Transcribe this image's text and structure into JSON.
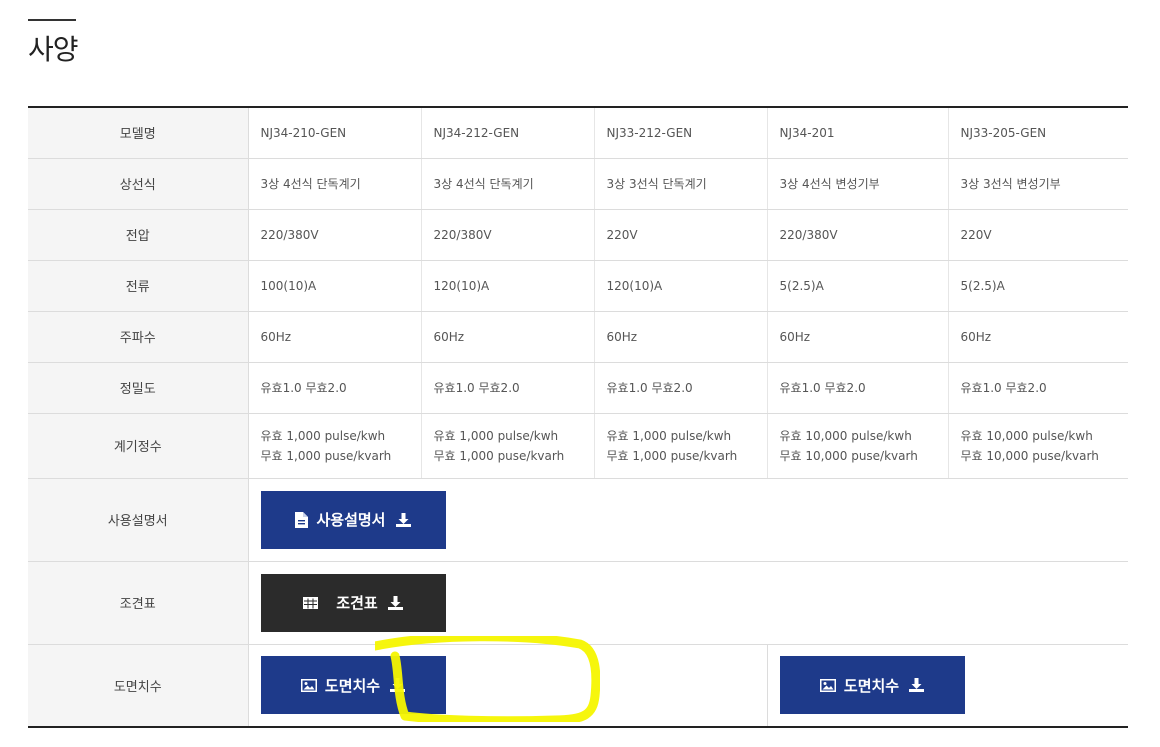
{
  "page": {
    "title": "사양"
  },
  "table": {
    "rows": [
      {
        "label": "모델명",
        "cells": [
          "NJ34-210-GEN",
          "NJ34-212-GEN",
          "NJ33-212-GEN",
          "NJ34-201",
          "NJ33-205-GEN"
        ]
      },
      {
        "label": "상선식",
        "cells": [
          "3상 4선식 단독계기",
          "3상 4선식 단독계기",
          "3상 3선식 단독계기",
          "3상 4선식 변성기부",
          "3상 3선식 변성기부"
        ]
      },
      {
        "label": "전압",
        "cells": [
          "220/380V",
          "220/380V",
          "220V",
          "220/380V",
          "220V"
        ]
      },
      {
        "label": "전류",
        "cells": [
          "100(10)A",
          "120(10)A",
          "120(10)A",
          "5(2.5)A",
          "5(2.5)A"
        ]
      },
      {
        "label": "주파수",
        "cells": [
          "60Hz",
          "60Hz",
          "60Hz",
          "60Hz",
          "60Hz"
        ]
      },
      {
        "label": "정밀도",
        "cells": [
          "유효1.0 무효2.0",
          "유효1.0 무효2.0",
          "유효1.0 무효2.0",
          "유효1.0 무효2.0",
          "유효1.0 무효2.0"
        ]
      },
      {
        "label": "계기정수",
        "cells": [
          [
            "유효 1,000 pulse/kwh",
            "무효 1,000 puse/kvarh"
          ],
          [
            "유효 1,000 pulse/kwh",
            "무효 1,000 puse/kvarh"
          ],
          [
            "유효 1,000 pulse/kwh",
            "무효 1,000 puse/kvarh"
          ],
          [
            "유효 10,000 pulse/kwh",
            "무효 10,000 puse/kvarh"
          ],
          [
            "유효 10,000 pulse/kwh",
            "무효 10,000 puse/kvarh"
          ]
        ]
      },
      {
        "label": "사용설명서",
        "button": "사용설명서"
      },
      {
        "label": "조견표",
        "button": "조견표"
      },
      {
        "label": "도면치수",
        "buttons": [
          "도면치수",
          "도면치수"
        ]
      }
    ]
  },
  "colors": {
    "button_blue": "#1e3a8a",
    "button_dark": "#2b2b2b",
    "highlight": "#f5f500"
  },
  "icons": {
    "manual": "document-icon",
    "table": "grid-icon",
    "drawing": "image-icon",
    "download": "download-icon"
  }
}
